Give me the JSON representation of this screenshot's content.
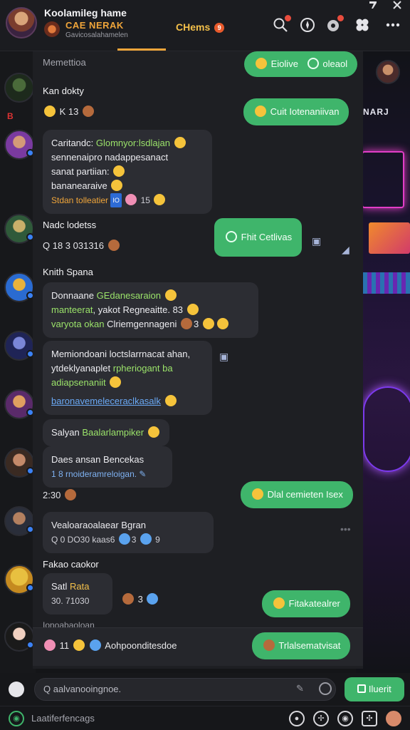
{
  "header": {
    "title": "Koolamileg hame",
    "brand": "CAE NERAK",
    "subtitle": "Gavicosalahamelen",
    "channels_label": "CHems",
    "channels_badge": "9"
  },
  "rail": {
    "mini_label": "B"
  },
  "chat": {
    "section_label": "Memettioa",
    "messages": [
      {
        "name": "Kan dokty",
        "meta": "K 13",
        "pill": "Eiolive",
        "pill2": "oleaol"
      },
      {
        "pill": "Cuit Iotenaniivan"
      },
      {
        "line1_a": "Caritandc:",
        "line1_b": "Glomnyor:lsdlajan",
        "line2": "sennenaipro nadappesanact",
        "line3": "sanat partiian:",
        "line4": "bananearaive",
        "foot_a": "Stdan tolleatier",
        "foot_tag": "IO",
        "foot_num": "15"
      },
      {
        "name": "Nadc lodetss",
        "meta": "Q 18 3 031316",
        "pill": "Fhit Cetlivas"
      },
      {
        "name": "Knith Spana",
        "line1_a": "Donnaane",
        "line1_b": "GEdanesaraion",
        "line2_a": "manteerat",
        "line2_b": "yakot Regneaitte. 83",
        "line3_a": "varyota okan",
        "line3_b": "Clriemgennageni",
        "line3_c": "3"
      },
      {
        "line1": "Memiondoani loctslarrnacat ahan,",
        "line2_a": "ytdeklyanaplet",
        "line2_b": "rpheriogant ba",
        "line3": "adiapsenaniit",
        "link": "baronavemeleceraclkasalk"
      },
      {
        "text_a": "Salyan",
        "text_b": "Baalarlampiker"
      },
      {
        "line1": "Daes ansan Bencekas",
        "line2": "1 8 rnoideramreloigan."
      },
      {
        "meta": "2:30",
        "pill": "Dlal cemieten Isex"
      },
      {
        "line1": "Vealoaraoalaear Bgran",
        "line2": "Q 0 DO30 kaas6",
        "count_a": "3",
        "count_b": "9"
      },
      {
        "name": "Fakao caokor",
        "line1_a": "Satl",
        "line1_b": "Rata",
        "line2": "30. 71030",
        "count": "3",
        "pill": "Fitakatealrer"
      }
    ],
    "cut_label": "Ionoabaoloan",
    "react_count": "11",
    "react_label": "Aohpoonditesdoe",
    "react_pill": "Trlalsematvisat"
  },
  "composer": {
    "placeholder": "Q aalvanooingnoe.",
    "send_label": "Iluerit"
  },
  "footer": {
    "label": "Laatiferfencags"
  },
  "right_bg": {
    "label": "NARJ"
  },
  "colors": {
    "accent": "#3fb56b",
    "header_accent": "#f0a53a",
    "bubble": "#2c2d33",
    "bg": "#1e1f23"
  }
}
